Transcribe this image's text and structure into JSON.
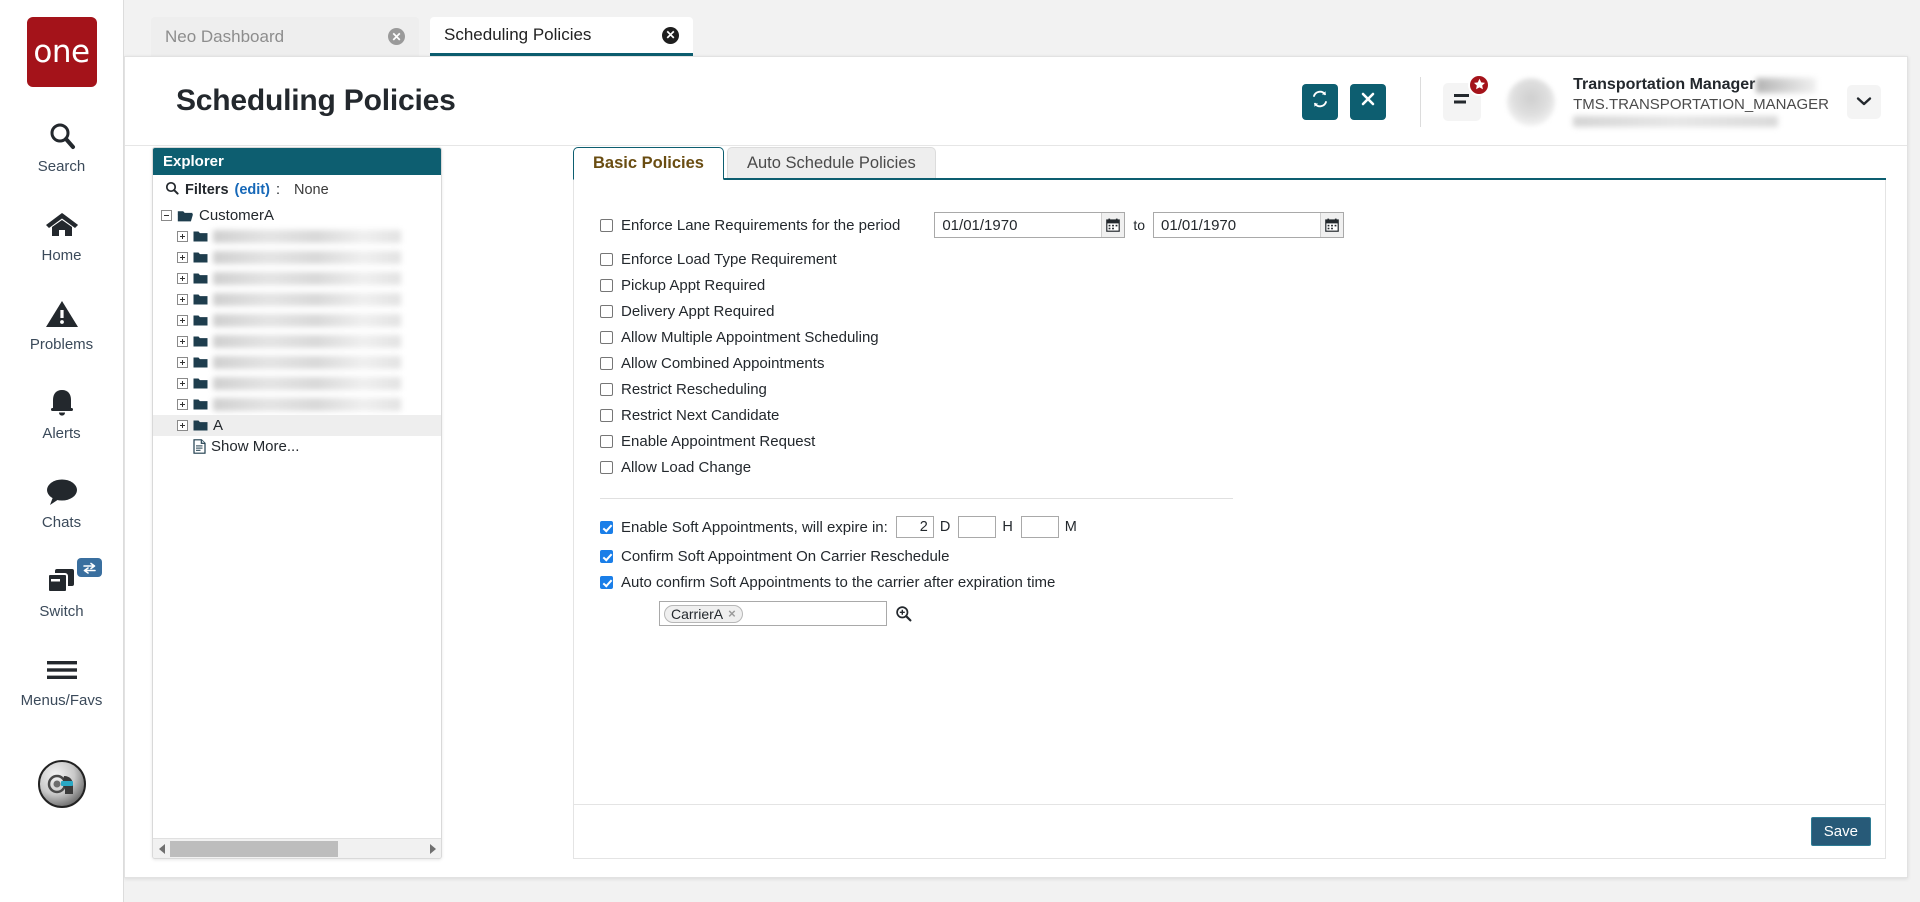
{
  "brand": {
    "logo_text": "one"
  },
  "rail": {
    "items": [
      {
        "label": "Search",
        "icon": "search-icon"
      },
      {
        "label": "Home",
        "icon": "home-icon"
      },
      {
        "label": "Problems",
        "icon": "warning-triangle-icon"
      },
      {
        "label": "Alerts",
        "icon": "bell-icon"
      },
      {
        "label": "Chats",
        "icon": "chat-bubble-icon"
      },
      {
        "label": "Switch",
        "icon": "windows-stack-icon"
      },
      {
        "label": "Menus/Favs",
        "icon": "hamburger-icon"
      }
    ],
    "assistant_icon": "ai-assistant-avatar-icon"
  },
  "browser_tabs": [
    {
      "title": "Neo Dashboard",
      "active": false
    },
    {
      "title": "Scheduling Policies",
      "active": true
    }
  ],
  "header": {
    "title": "Scheduling Policies",
    "refresh_icon": "refresh-icon",
    "close_icon": "close-x-icon",
    "menu_icon": "menu-lines-icon",
    "badge_icon": "star-icon",
    "caret_icon": "chevron-down-icon",
    "user_name": "Transportation Manager",
    "user_role": "TMS.TRANSPORTATION_MANAGER"
  },
  "explorer": {
    "title": "Explorer",
    "search_icon": "search-icon",
    "filters_label": "Filters",
    "filters_edit": "(edit)",
    "filters_colon": ":",
    "filters_value": "None",
    "root": {
      "label": "CustomerA",
      "expanded": true
    },
    "blurred_children_count": 9,
    "visible_child": {
      "label": "A",
      "selected": true
    },
    "show_more": "Show More...",
    "scroll_left_icon": "scroll-left-arrow-icon",
    "scroll_right_icon": "scroll-right-arrow-icon"
  },
  "content_tabs": [
    {
      "label": "Basic Policies",
      "active": true
    },
    {
      "label": "Auto Schedule Policies",
      "active": false
    }
  ],
  "form": {
    "lane_row": {
      "label": "Enforce Lane Requirements for the period",
      "checked": false,
      "date_from": "01/01/1970",
      "date_to": "01/01/1970",
      "separator": "to",
      "calendar_icon": "calendar-icon"
    },
    "checkboxes": [
      {
        "label": "Enforce Load Type Requirement",
        "checked": false
      },
      {
        "label": "Pickup Appt Required",
        "checked": false
      },
      {
        "label": "Delivery Appt Required",
        "checked": false
      },
      {
        "label": "Allow Multiple Appointment Scheduling",
        "checked": false
      },
      {
        "label": "Allow Combined Appointments",
        "checked": false
      },
      {
        "label": "Restrict Rescheduling",
        "checked": false
      },
      {
        "label": "Restrict Next Candidate",
        "checked": false
      },
      {
        "label": "Enable Appointment Request",
        "checked": false
      },
      {
        "label": "Allow Load Change",
        "checked": false
      }
    ],
    "soft_appointments": {
      "enable_label": "Enable Soft Appointments, will expire in:",
      "enable_checked": true,
      "days_value": "2",
      "days_unit": "D",
      "hours_value": "",
      "hours_unit": "H",
      "minutes_value": "",
      "minutes_unit": "M",
      "confirm_label": "Confirm Soft Appointment On Carrier Reschedule",
      "confirm_checked": true,
      "auto_confirm_label": "Auto confirm Soft Appointments to the carrier after expiration time",
      "auto_confirm_checked": true,
      "carrier_chip": "CarrierA",
      "carrier_chip_remove": "×",
      "carrier_search_icon": "search-magnifier-icon"
    }
  },
  "footer": {
    "save_label": "Save"
  },
  "colors": {
    "brand_red": "#a4131a",
    "teal": "#0d5e70",
    "checkbox_blue": "#1a7ee8",
    "save_blue": "#275a78",
    "link_blue": "#1668b8"
  }
}
